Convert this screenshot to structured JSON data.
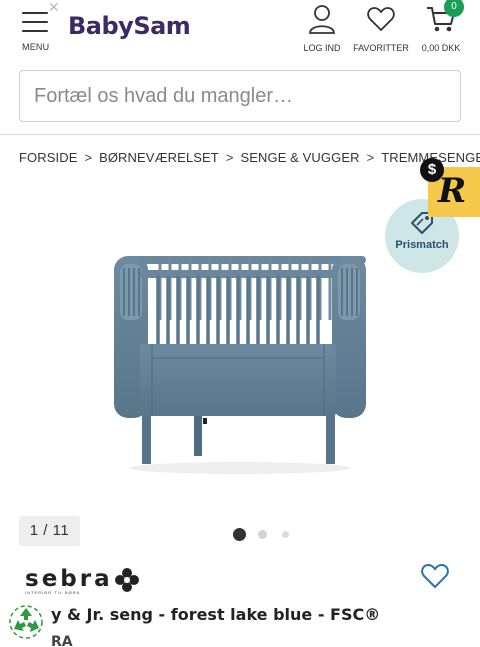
{
  "header": {
    "menu_label": "MENU",
    "logo": "BabySam",
    "login_label": "LOG IND",
    "favorites_label": "FAVORITTER",
    "cart_label": "0,00 DKK",
    "cart_count": "0"
  },
  "search": {
    "placeholder": "Fortæl os hvad du mangler…"
  },
  "breadcrumb": [
    "FORSIDE",
    "BØRNEVÆRELSET",
    "SENGE & VUGGER",
    "TREMMESENGE"
  ],
  "prismatch": {
    "label": "Prismatch"
  },
  "extension": {
    "letter": "R",
    "dollar": "$"
  },
  "gallery": {
    "pager": "1 / 11",
    "active_dot": 1
  },
  "product": {
    "brand": "sebra",
    "brand_tagline": "INTERIØR TIL BØRN",
    "title_visible": "y & Jr. seng - forest lake blue - FSC®",
    "subline_visible": "RA"
  },
  "colors": {
    "brand_purple": "#3b2a63",
    "cart_badge": "#1a9e57",
    "prismatch_bg": "#cfe6e6",
    "crib_blue": "#5f7d92",
    "wishlist_blue": "#2f6fb5",
    "extension_yellow": "#f6c84c"
  },
  "icons": {
    "menu": "hamburger-icon",
    "close": "close-icon",
    "login": "user-icon",
    "favorites": "heart-icon",
    "cart": "cart-icon",
    "prismatch": "price-tag-icon",
    "wishlist": "heart-outline-icon",
    "recycle": "recycle-icon"
  }
}
